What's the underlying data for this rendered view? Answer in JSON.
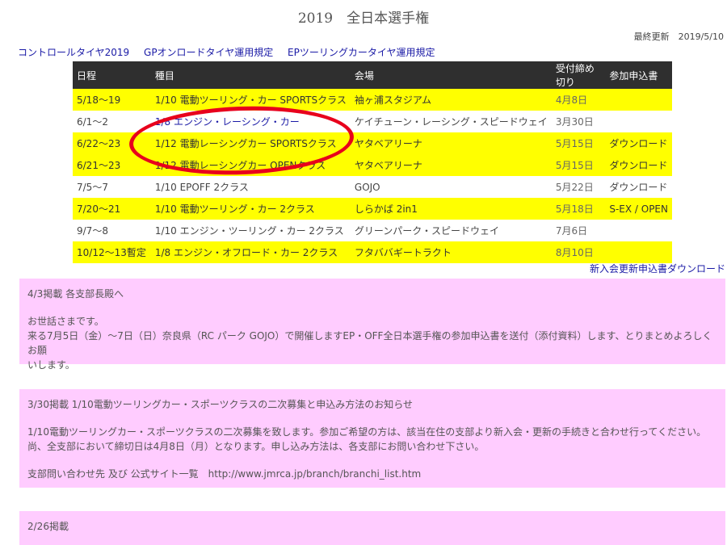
{
  "title": "2019　全日本選手権",
  "updated": "最終更新　2019/5/10",
  "top_links": [
    "コントロールタイヤ2019",
    "GPオンロードタイヤ運用規定",
    "EPツーリングカータイヤ運用規定"
  ],
  "table": {
    "headers": [
      "日程",
      "種目",
      "会場",
      "受付締め切り",
      "参加申込書"
    ],
    "rows": [
      {
        "date": "5/18〜19",
        "event": "1/10 電動ツーリング・カー SPORTSクラス",
        "venue": "袖ヶ浦スタジアム",
        "deadline": "4月8日",
        "apply": ""
      },
      {
        "date": "6/1〜2",
        "event": "1/8 エンジン・レーシング・カー",
        "venue": "ケイチューン・レーシング・スピードウェイ",
        "deadline": "3月30日",
        "apply": ""
      },
      {
        "date": "6/22〜23",
        "event": "1/12 電動レーシングカー SPORTSクラス",
        "venue": "ヤタベアリーナ",
        "deadline": "5月15日",
        "apply": "ダウンロード"
      },
      {
        "date": "6/21〜23",
        "event": "1/12 電動レーシングカー OPENクラス",
        "venue": "ヤタベアリーナ",
        "deadline": "5月15日",
        "apply": "ダウンロード"
      },
      {
        "date": "7/5〜7",
        "event": "1/10 EPOFF 2クラス",
        "venue": "GOJO",
        "deadline": "5月22日",
        "apply": "ダウンロード"
      },
      {
        "date": "7/20〜21",
        "event": "1/10 電動ツーリング・カー 2クラス",
        "venue": "しらかば 2in1",
        "deadline": "5月18日",
        "apply": "S-EX / OPEN"
      },
      {
        "date": "9/7〜8",
        "event": "1/10 エンジン・ツーリング・カー 2クラス",
        "venue": "グリーンパーク・スピードウェイ",
        "deadline": "7月6日",
        "apply": ""
      },
      {
        "date": "10/12〜13暫定",
        "event": "1/8 エンジン・オフロード・カー 2クラス",
        "venue": "フタババギートラクト",
        "deadline": "8月10日",
        "apply": ""
      }
    ]
  },
  "renew_link": "新入会更新申込書ダウンロード",
  "notices": [
    {
      "heading": "4/3掲載 各支部長殿へ",
      "lines": [
        "お世話さまです。",
        "来る7月5日（金）〜7日（日）奈良県（RC パーク GOJO）で開催しますEP・OFF全日本選手権の参加申込書を送付（添付資料）します、とりまとめよろしくお願",
        "いします。"
      ]
    },
    {
      "heading": "3/30掲載 1/10電動ツーリングカー・スポーツクラスの二次募集と申込み方法のお知らせ",
      "lines": [
        "1/10電動ツーリングカー・スポーツクラスの二次募集を致します。参加ご希望の方は、該当在住の支部より新入会・更新の手続きと合わせ行ってください。",
        "尚、全支部において締切日は4月8日（月）となります。申し込み方法は、各支部にお問い合わせ下さい。"
      ],
      "link_line": "支部問い合わせ先 及び 公式サイト一覧　http://www.jmrca.jp/branch/branchi_list.htm"
    },
    {
      "heading": "2/26掲載"
    }
  ],
  "colors": {
    "highlight": "#ffff00",
    "notice_bg": "#ffccff",
    "header_bg": "#2f2f2f",
    "link": "#1a1aa6",
    "oval": "#e8001c"
  }
}
